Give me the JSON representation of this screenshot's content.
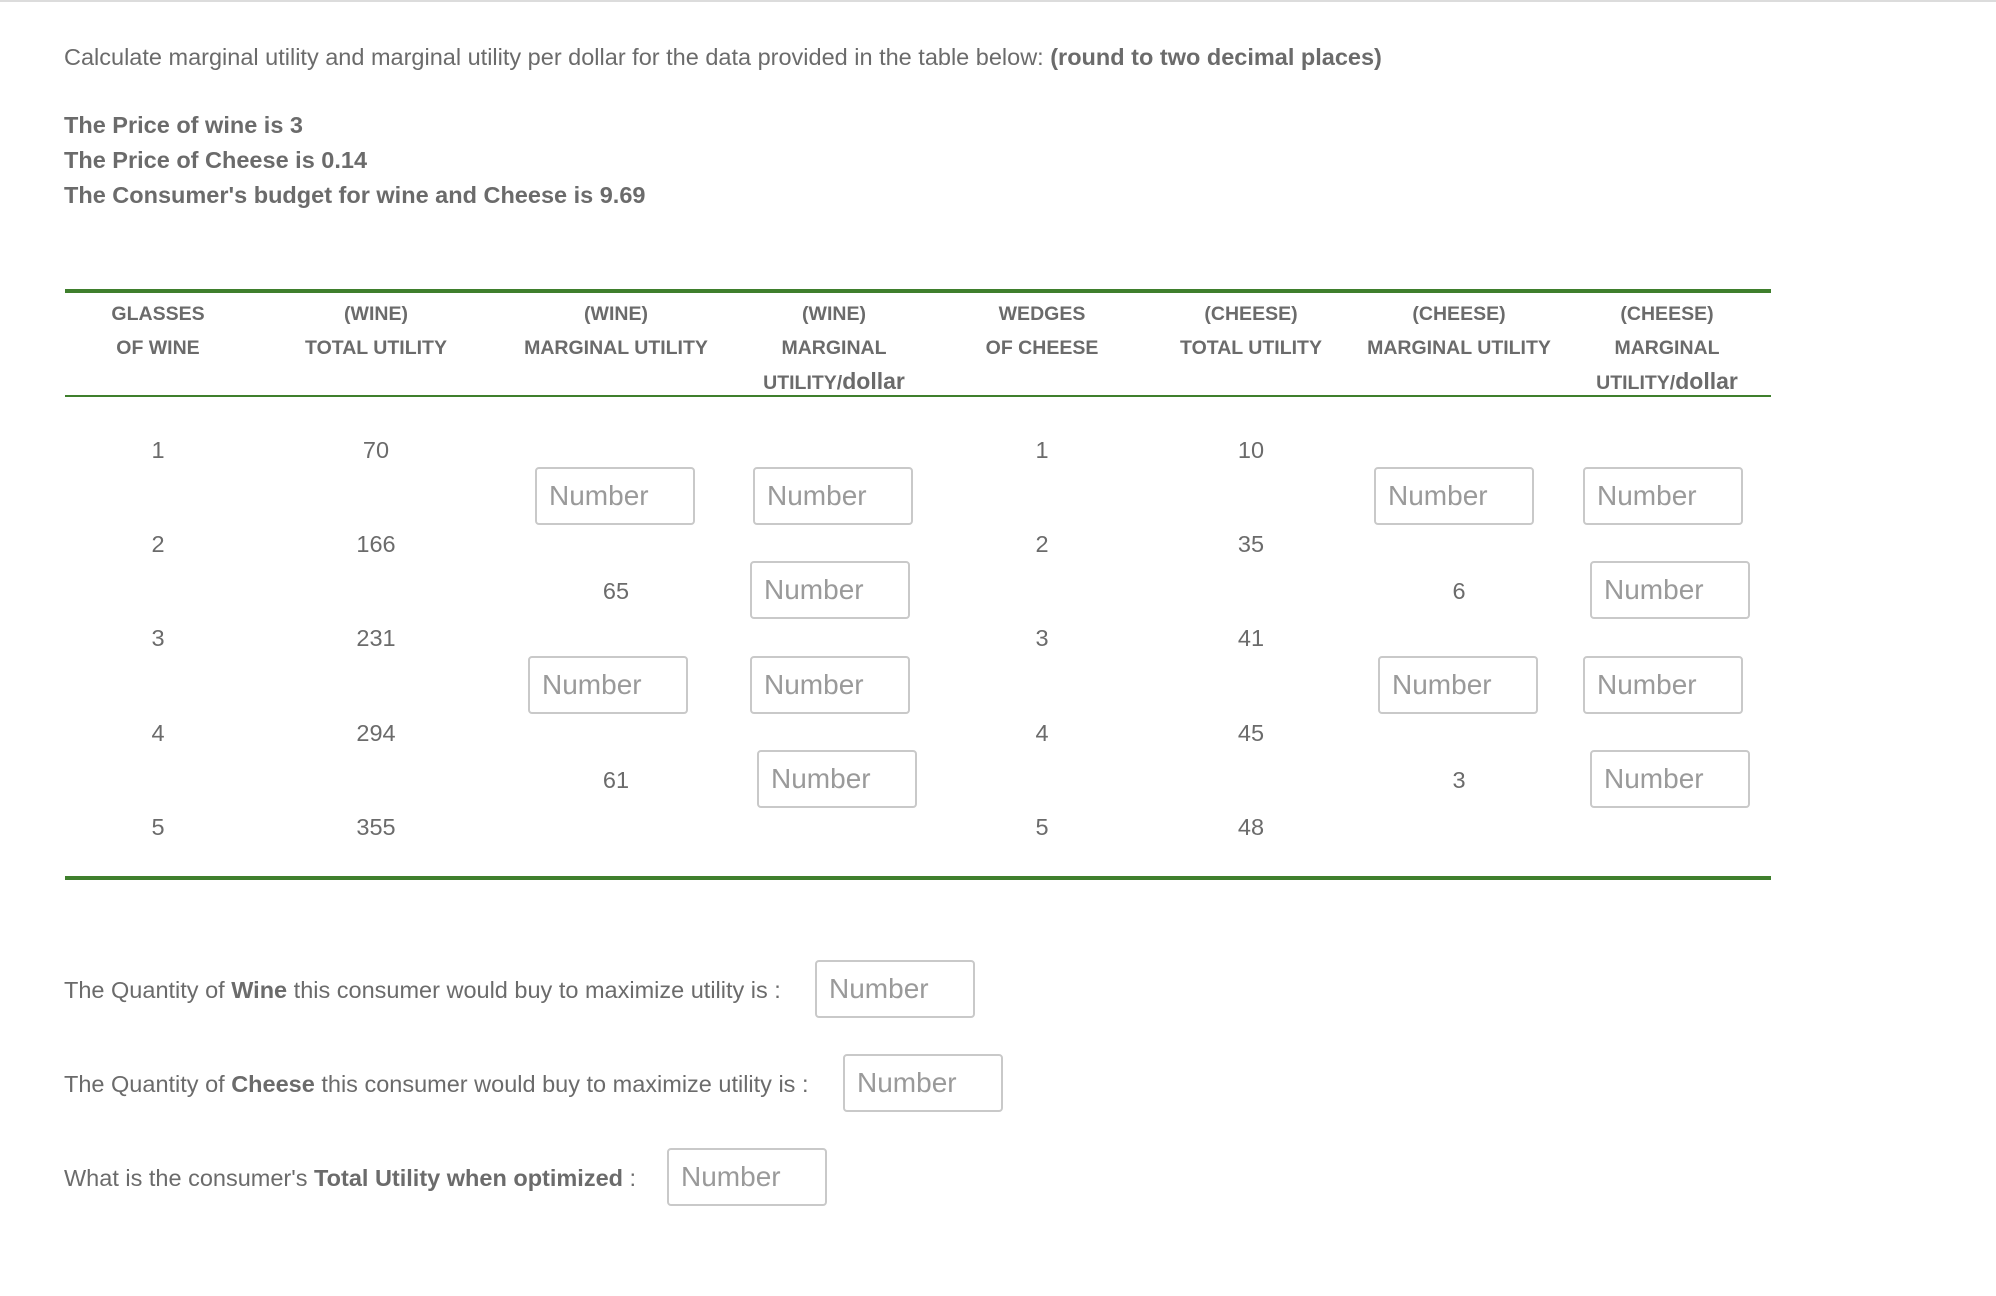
{
  "instruction": {
    "text": "Calculate marginal utility and marginal utility per dollar for the data provided in the table below: ",
    "bold": "(round to two decimal places)"
  },
  "info": {
    "wine_price": "The Price of wine is 3",
    "cheese_price": "The Price of Cheese is 0.14",
    "budget": "The Consumer's budget for wine and Cheese is 9.69"
  },
  "headers": [
    {
      "line1": "GLASSES",
      "line2": "OF WINE",
      "line3": ""
    },
    {
      "line1": "(WINE)",
      "line2": "TOTAL UTILITY",
      "line3": ""
    },
    {
      "line1": "(WINE)",
      "line2": "MARGINAL UTILITY",
      "line3": ""
    },
    {
      "line1": "(WINE)",
      "line2": "MARGINAL",
      "line3": "UTILITY/",
      "line3b": "dollar"
    },
    {
      "line1": "WEDGES",
      "line2": "OF CHEESE",
      "line3": ""
    },
    {
      "line1": "(CHEESE)",
      "line2": "TOTAL UTILITY",
      "line3": ""
    },
    {
      "line1": "(CHEESE)",
      "line2": "MARGINAL UTILITY",
      "line3": ""
    },
    {
      "line1": "(CHEESE)",
      "line2": "MARGINAL",
      "line3": "UTILITY/",
      "line3b": "dollar"
    }
  ],
  "wine_qty": [
    "1",
    "2",
    "3",
    "4",
    "5"
  ],
  "wine_tu": [
    "70",
    "166",
    "231",
    "294",
    "355"
  ],
  "cheese_qty": [
    "1",
    "2",
    "3",
    "4",
    "5"
  ],
  "cheese_tu": [
    "10",
    "35",
    "41",
    "45",
    "48"
  ],
  "wine_mu_given": {
    "row2": "65",
    "row4": "61"
  },
  "cheese_mu_given": {
    "row2": "6",
    "row4": "3"
  },
  "placeholder": "Number",
  "questions": {
    "q1_pre": "The Quantity of ",
    "q1_bold": "Wine",
    "q1_post": " this consumer would buy to maximize utility is :",
    "q2_pre": "The Quantity of ",
    "q2_bold": "Cheese",
    "q2_post": " this consumer would buy to maximize utility is :",
    "q3_pre": "What is the consumer's ",
    "q3_bold": "Total Utility when optimized",
    "q3_post": " :"
  }
}
